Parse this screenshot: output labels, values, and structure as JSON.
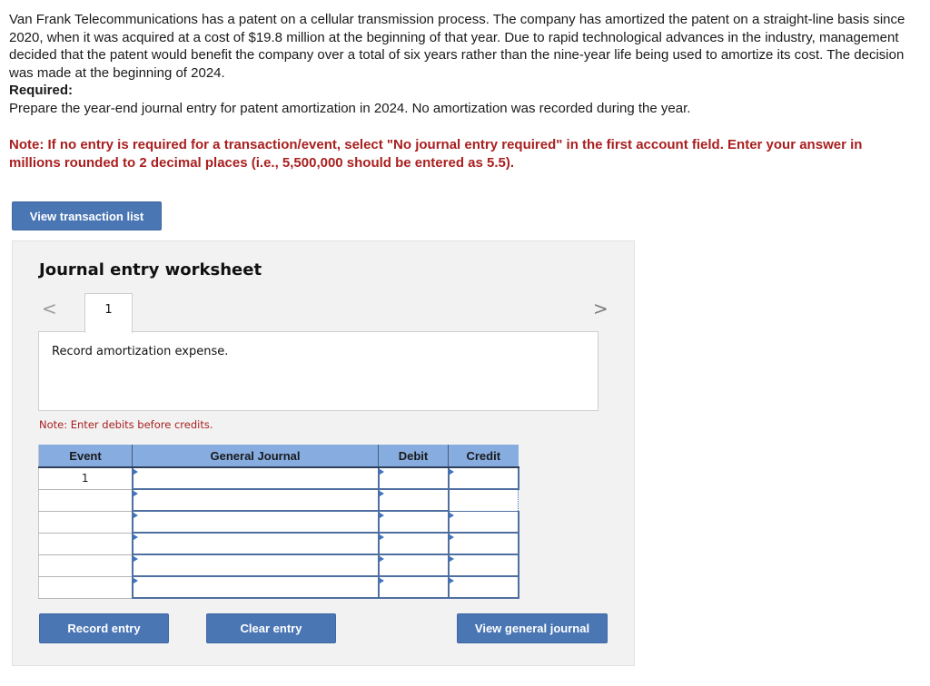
{
  "problem": {
    "paragraph": "Van Frank Telecommunications has a patent on a cellular transmission process. The company has amortized the patent on a straight-line basis since 2020, when it was acquired at a cost of $19.8 million at the beginning of that year. Due to rapid technological advances in the industry, management decided that the patent would benefit the company over a total of six years rather than the nine-year life being used to amortize its cost. The decision was made at the beginning of 2024.",
    "required_label": "Required:",
    "required_text": "Prepare the year-end journal entry for patent amortization in 2024. No amortization was recorded during the year."
  },
  "note": "Note: If no entry is required for a transaction/event, select \"No journal entry required\" in the first account field. Enter your answer in millions rounded to 2 decimal places (i.e., 5,500,000 should be entered as 5.5).",
  "buttons": {
    "view_transaction_list": "View transaction list",
    "record_entry": "Record entry",
    "clear_entry": "Clear entry",
    "view_general_journal": "View general journal"
  },
  "worksheet": {
    "title": "Journal entry worksheet",
    "prev_icon": "<",
    "next_icon": ">",
    "tabs": [
      {
        "label": "1"
      }
    ],
    "description": "Record amortization expense.",
    "note": "Note: Enter debits before credits.",
    "table": {
      "headers": {
        "event": "Event",
        "general_journal": "General Journal",
        "debit": "Debit",
        "credit": "Credit"
      },
      "rows": [
        {
          "event": "1",
          "account": "",
          "debit": "",
          "credit": ""
        },
        {
          "event": "",
          "account": "",
          "debit": "",
          "credit": ""
        },
        {
          "event": "",
          "account": "",
          "debit": "",
          "credit": ""
        },
        {
          "event": "",
          "account": "",
          "debit": "",
          "credit": ""
        },
        {
          "event": "",
          "account": "",
          "debit": "",
          "credit": ""
        },
        {
          "event": "",
          "account": "",
          "debit": "",
          "credit": ""
        }
      ],
      "focused_cell": {
        "row": 2,
        "column": "credit"
      }
    }
  },
  "colors": {
    "button_blue": "#4a76b4",
    "header_blue": "#86ace0",
    "note_red": "#a91f1f"
  }
}
